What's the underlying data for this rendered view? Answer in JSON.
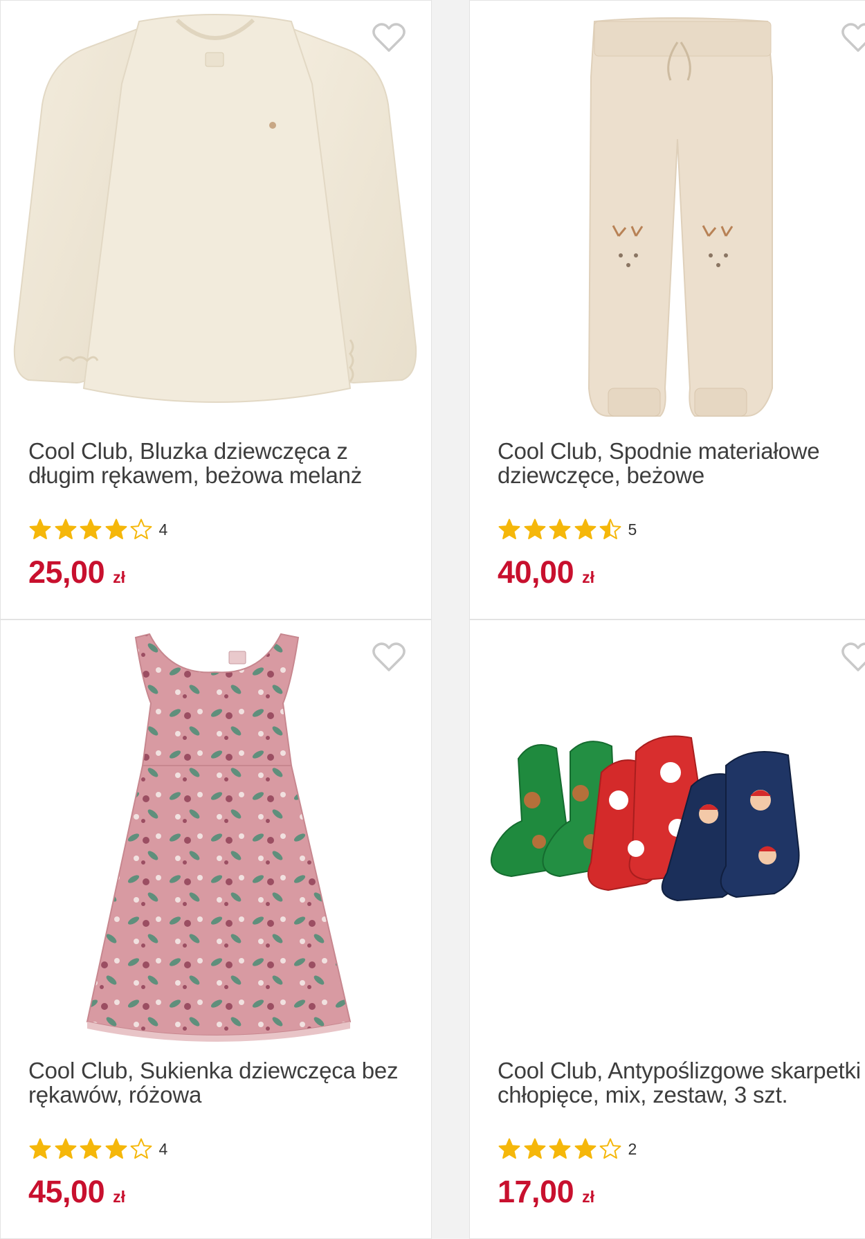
{
  "colors": {
    "price": "#c8102e",
    "star": "#f5b70a",
    "heart_outline": "#c9c9c9"
  },
  "products": [
    {
      "title": "Cool Club, Bluzka dziewczęca z długim rękawem, beżowa melanż",
      "rating": 4,
      "rating_count": "4",
      "price": "25,00",
      "currency": "zł",
      "image": "beige-knit-sweater"
    },
    {
      "title": "Cool Club, Spodnie materiałowe dziewczęce, beżowe",
      "rating": 4.5,
      "rating_count": "5",
      "price": "40,00",
      "currency": "zł",
      "image": "beige-reindeer-trousers"
    },
    {
      "title": "Cool Club, Sukienka dziewczęca bez rękawów, różowa",
      "rating": 4,
      "rating_count": "4",
      "price": "45,00",
      "currency": "zł",
      "image": "pink-floral-dress"
    },
    {
      "title": "Cool Club, Antypoślizgowe skarpetki chłopięce, mix, zestaw, 3 szt.",
      "rating": 4,
      "rating_count": "2",
      "price": "17,00",
      "currency": "zł",
      "image": "christmas-socks-set"
    }
  ]
}
